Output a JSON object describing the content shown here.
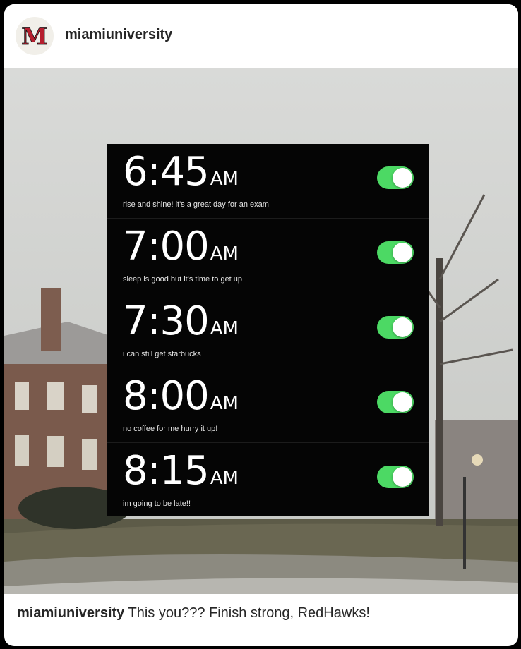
{
  "post": {
    "username": "miamiuniversity",
    "avatar_logo": "M",
    "avatar_icon": "miami-m-logo-icon"
  },
  "alarms": [
    {
      "time": "6:45",
      "period": "AM",
      "label": "rise and shine! it's a great day for an exam",
      "enabled": true
    },
    {
      "time": "7:00",
      "period": "AM",
      "label": "sleep is good but it's time to get up",
      "enabled": true
    },
    {
      "time": "7:30",
      "period": "AM",
      "label": "i can still get starbucks",
      "enabled": true
    },
    {
      "time": "8:00",
      "period": "AM",
      "label": "no coffee for me hurry it up!",
      "enabled": true
    },
    {
      "time": "8:15",
      "period": "AM",
      "label": "im going to be late!!",
      "enabled": true
    }
  ],
  "caption": {
    "username": "miamiuniversity",
    "text": "This you??? Finish strong, RedHawks!"
  },
  "colors": {
    "toggle_on": "#4cd964",
    "logo_red": "#b61e2e"
  }
}
